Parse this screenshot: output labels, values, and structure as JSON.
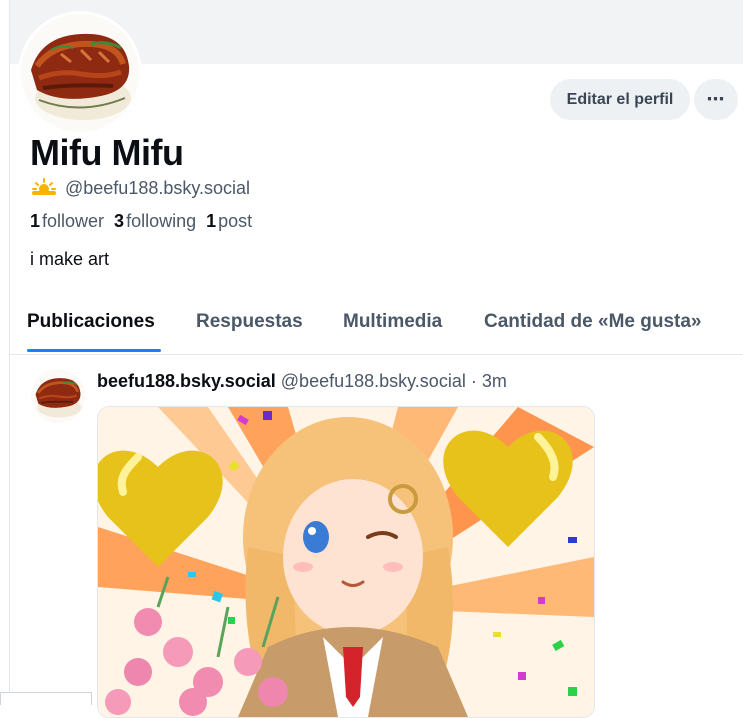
{
  "profile": {
    "display_name": "Mifu Mifu",
    "handle": "@beefu188.bsky.social",
    "handle_icon": "sun-cloud-icon",
    "stats": {
      "followers_count": "1",
      "followers_label": "follower",
      "following_count": "3",
      "following_label": "following",
      "posts_count": "1",
      "posts_label": "post"
    },
    "bio": "i make art"
  },
  "actions": {
    "edit_profile": "Editar el perfil",
    "more": "⋯"
  },
  "tabs": [
    {
      "label": "Publicaciones",
      "active": true
    },
    {
      "label": "Respuestas",
      "active": false
    },
    {
      "label": "Multimedia",
      "active": false
    },
    {
      "label": "Cantidad de «Me gusta»",
      "active": false
    }
  ],
  "post": {
    "author": "beefu188.bsky.social",
    "handle": "@beefu188.bsky.social",
    "separator": "·",
    "time": "3m"
  },
  "colors": {
    "accent": "#1083fe",
    "banner": "#f1f3f5",
    "muted_text": "#4b5868"
  }
}
